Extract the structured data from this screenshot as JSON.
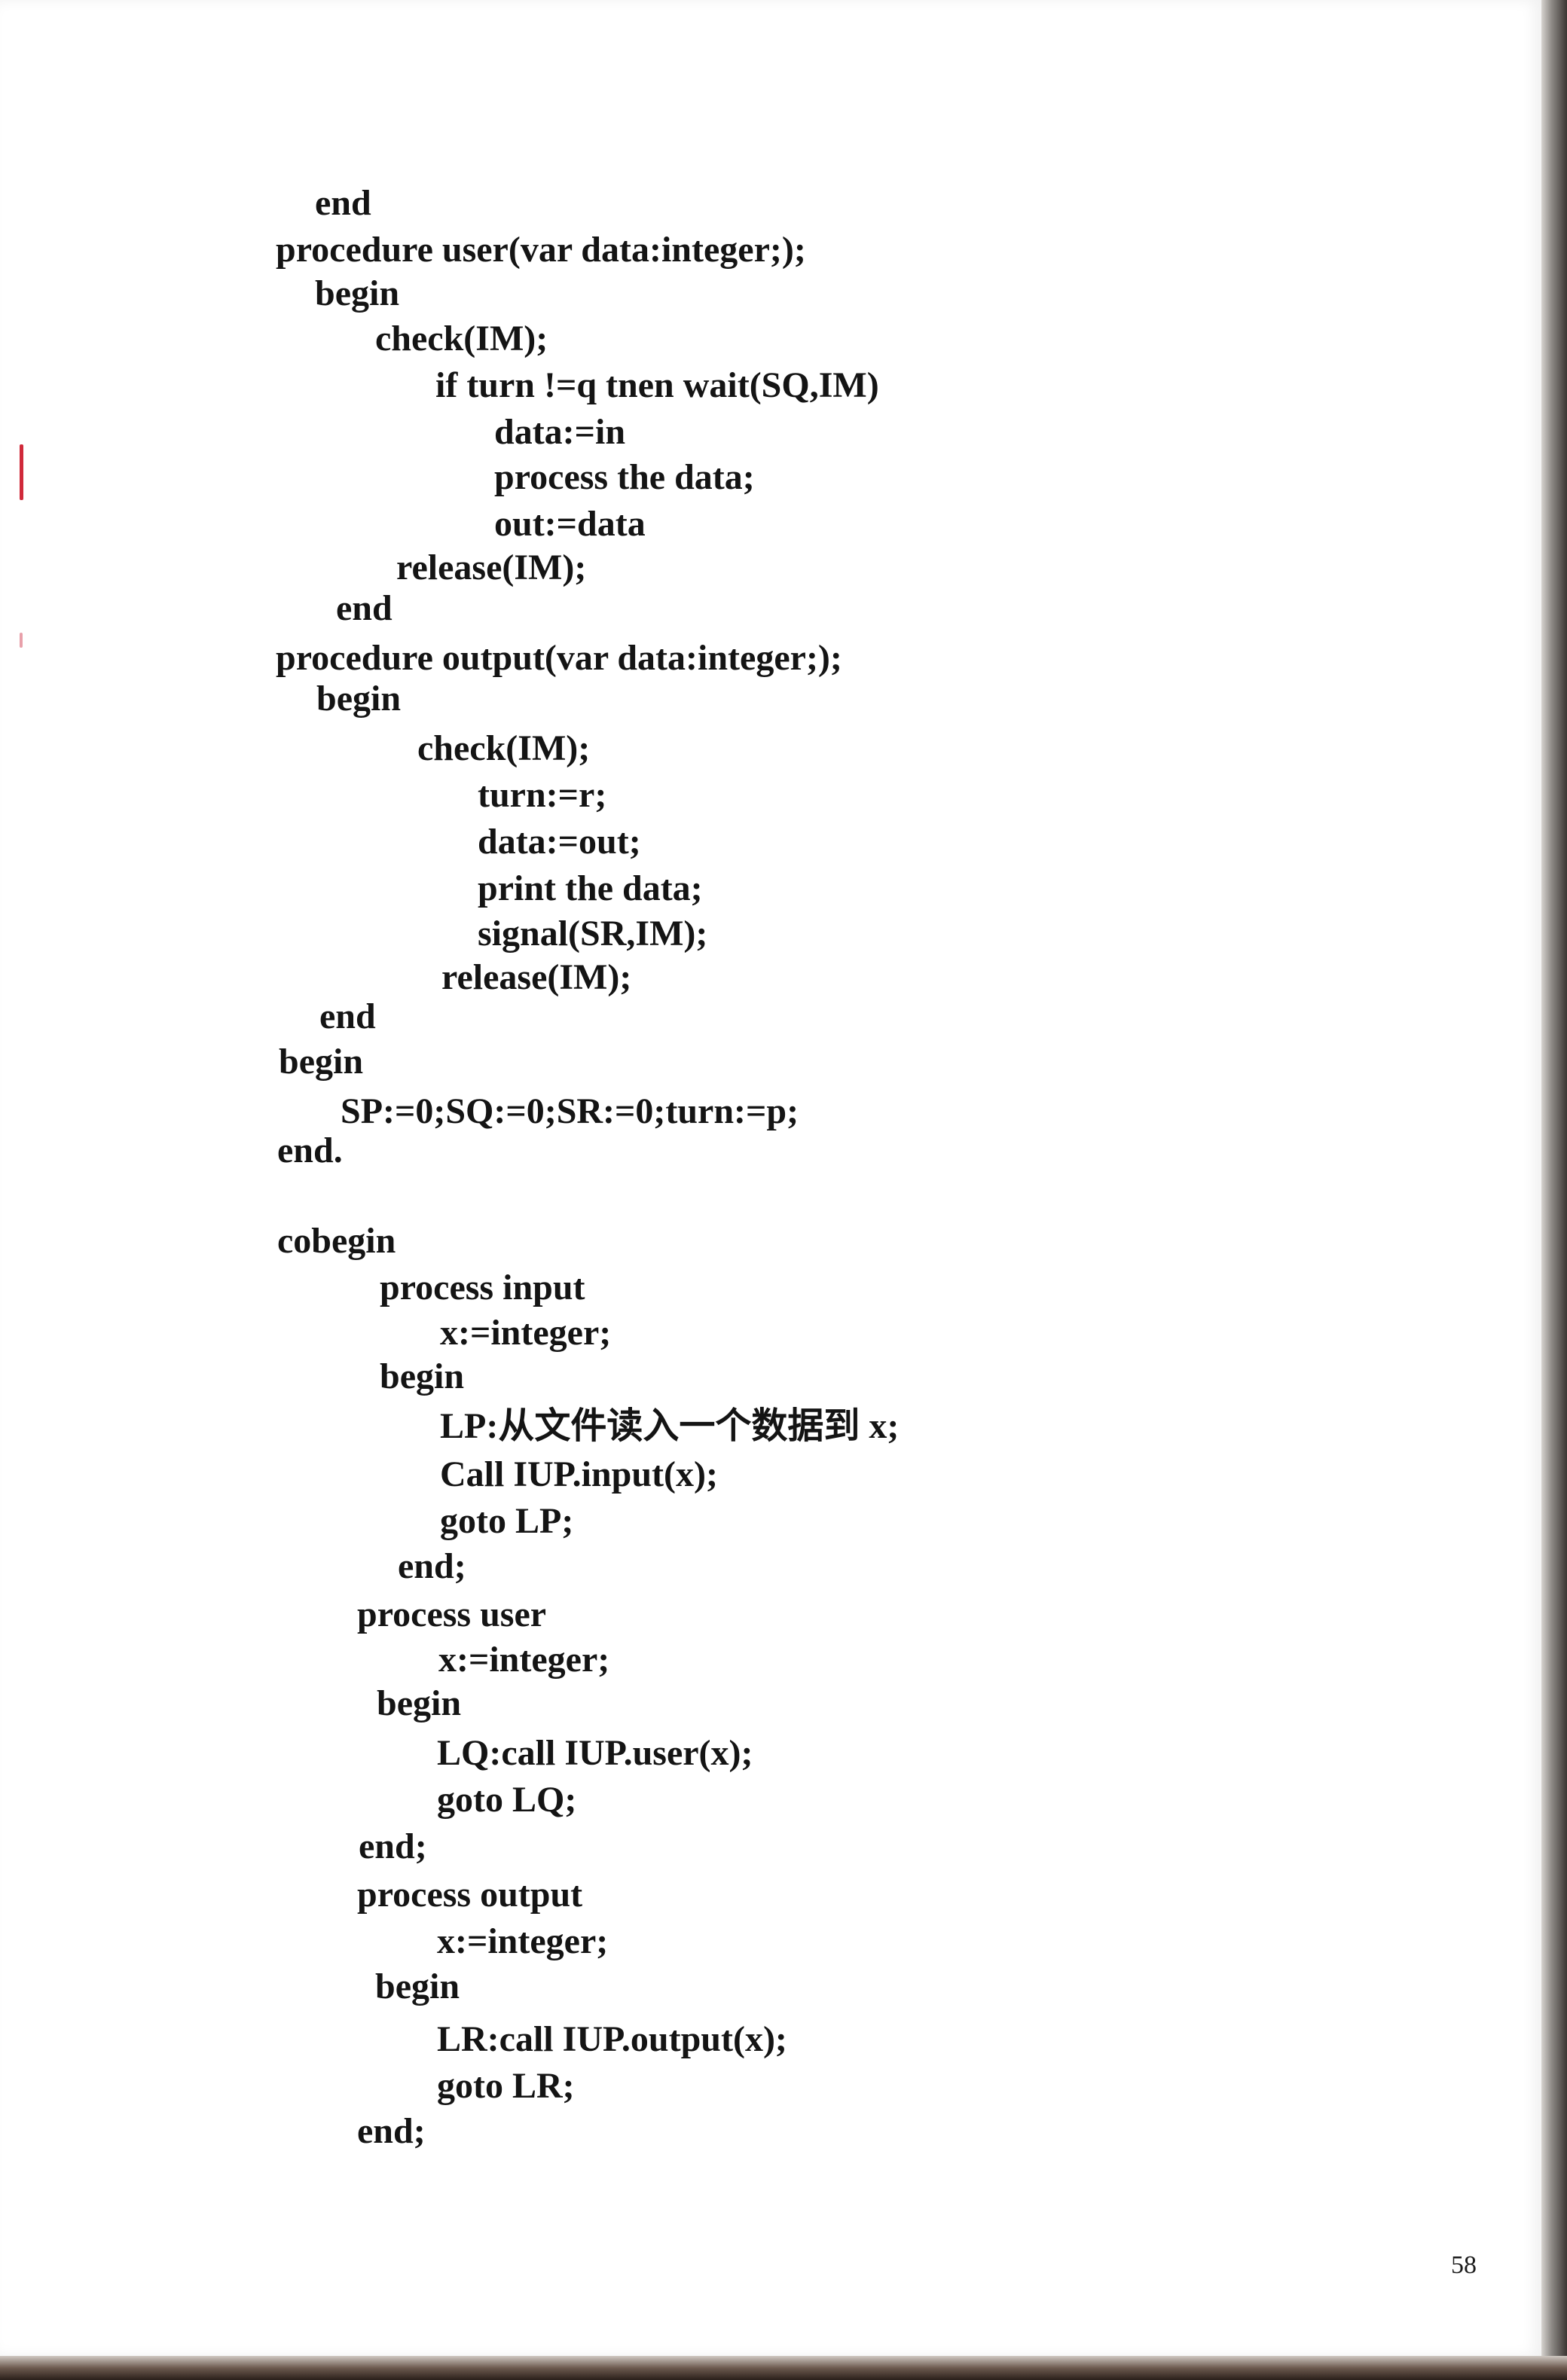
{
  "document": {
    "lines": [
      "end",
      "procedure user(var data:integer;);",
      "begin",
      "check(IM);",
      "if turn !=q tnen wait(SQ,IM)",
      "data:=in",
      "process the data;",
      "out:=data",
      "release(IM);",
      "end",
      "procedure output(var data:integer;);",
      "begin",
      "check(IM);",
      "turn:=r;",
      "data:=out;",
      "print the data;",
      "signal(SR,IM);",
      "release(IM);",
      "end",
      "begin",
      "SP:=0;SQ:=0;SR:=0;turn:=p;",
      "end.",
      "cobegin",
      "process input",
      "x:=integer;",
      "begin",
      "LP:从文件读入一个数据到 x;",
      "Call IUP.input(x);",
      "goto LP;",
      "end;",
      "process user",
      "x:=integer;",
      "begin",
      "LQ:call IUP.user(x);",
      "goto LQ;",
      "end;",
      "process output",
      "x:=integer;",
      "begin",
      "LR:call IUP.output(x);",
      "goto LR;",
      "end;"
    ],
    "page_number": "58"
  }
}
